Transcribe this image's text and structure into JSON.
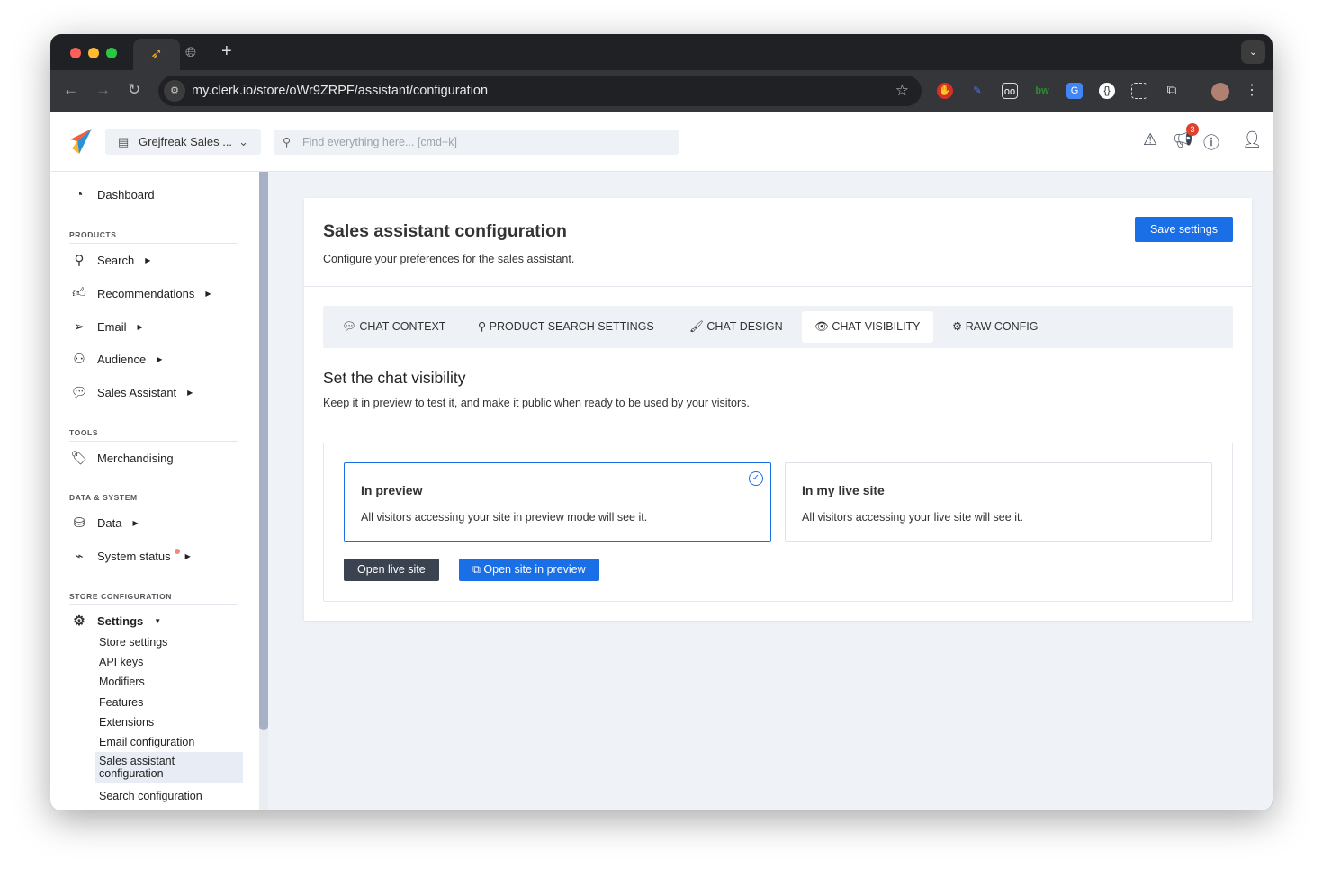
{
  "browser": {
    "url": "my.clerk.io/store/oWr9ZRPF/assistant/configuration",
    "notification_count": "3"
  },
  "header": {
    "store_name": "Grejfreak Sales ...",
    "search_placeholder": "Find everything here... [cmd+k]"
  },
  "sidebar": {
    "dashboard": "Dashboard",
    "sections": {
      "products": "PRODUCTS",
      "tools": "TOOLS",
      "data_system": "DATA & SYSTEM",
      "store_config": "STORE CONFIGURATION"
    },
    "items": {
      "search": "Search",
      "recommendations": "Recommendations",
      "email": "Email",
      "audience": "Audience",
      "sales_assistant": "Sales Assistant",
      "merchandising": "Merchandising",
      "data": "Data",
      "system_status": "System status",
      "settings": "Settings"
    },
    "settings_sub": [
      "Store settings",
      "API keys",
      "Modifiers",
      "Features",
      "Extensions",
      "Email configuration",
      "Sales assistant configuration",
      "Search configuration"
    ]
  },
  "main": {
    "title": "Sales assistant configuration",
    "description": "Configure your preferences for the sales assistant.",
    "save_label": "Save settings",
    "tabs": [
      "CHAT CONTEXT",
      "PRODUCT SEARCH SETTINGS",
      "CHAT DESIGN",
      "CHAT VISIBILITY",
      "RAW CONFIG"
    ],
    "active_tab": "CHAT VISIBILITY",
    "section_title": "Set the chat visibility",
    "section_desc": "Keep it in preview to test it, and make it public when ready to be used by your visitors.",
    "options": [
      {
        "title": "In preview",
        "desc": "All visitors accessing your site in preview mode will see it.",
        "selected": true
      },
      {
        "title": "In my live site",
        "desc": "All visitors accessing your live site will see it.",
        "selected": false
      }
    ],
    "open_live_label": "Open live site",
    "open_preview_label": "Open site in preview"
  },
  "colors": {
    "accent": "#1a6ee6",
    "dark_button": "#3b4351"
  }
}
